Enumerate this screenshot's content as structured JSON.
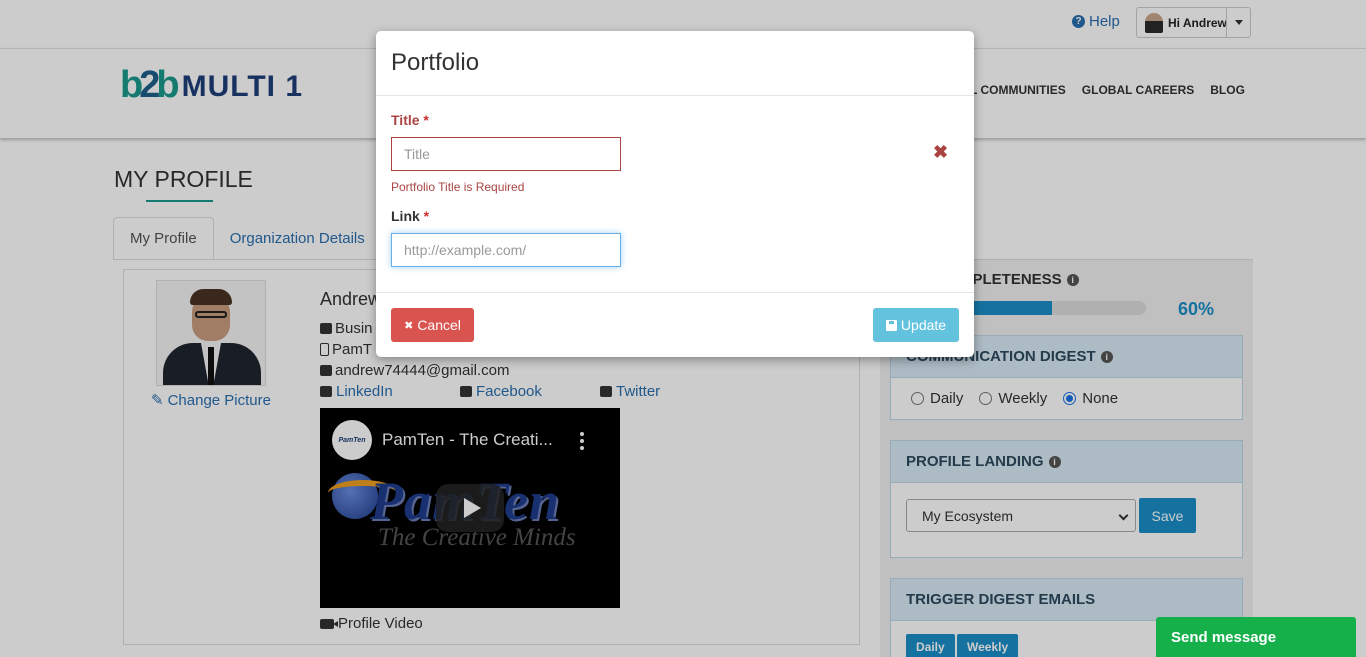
{
  "topbar": {
    "help_label": "Help",
    "help_icon_glyph": "?",
    "user_greeting": "Hi Andrew"
  },
  "brand": {
    "logo_mark_b": "b",
    "logo_mark_2": "2",
    "logo_mark_b2": "b",
    "logo_text": "MULTI 1"
  },
  "nav": {
    "items": [
      "L COMMUNITIES",
      "GLOBAL CAREERS",
      "BLOG"
    ]
  },
  "page": {
    "title": "MY PROFILE"
  },
  "tabs": [
    {
      "label": "My Profile",
      "active": true
    },
    {
      "label": "Organization Details",
      "active": false
    }
  ],
  "profile": {
    "change_picture": "Change Picture",
    "name": "Andrew",
    "business": "Busin",
    "org": "PamT",
    "email": "andrew74444@gmail.com",
    "social": {
      "linkedin": "LinkedIn",
      "facebook": "Facebook",
      "twitter": "Twitter"
    },
    "video": {
      "channel_badge": "PamTen",
      "title": "PamTen - The Creati...",
      "brand_text": "PamTen",
      "tagline": "The Creative Minds"
    },
    "video_label": "Profile Video"
  },
  "sidebar": {
    "completeness_label": "MPLETENESS",
    "completeness_value": 60,
    "completeness_text": "60%",
    "digest": {
      "title": "COMMUNICATION DIGEST",
      "options": [
        "Daily",
        "Weekly",
        "None"
      ],
      "selected": "None"
    },
    "landing": {
      "title": "PROFILE LANDING",
      "selected": "My Ecosystem",
      "save_label": "Save"
    },
    "trigger": {
      "title": "TRIGGER DIGEST EMAILS",
      "buttons": [
        "Daily",
        "Weekly"
      ]
    }
  },
  "chat": {
    "label": "Send message"
  },
  "modal": {
    "title": "Portfolio",
    "title_field": {
      "label": "Title",
      "required_mark": "*",
      "placeholder": "Title",
      "error": "Portfolio Title is Required"
    },
    "link_field": {
      "label": "Link",
      "required_mark": "*",
      "placeholder": "http://example.com/"
    },
    "remove_glyph": "✖",
    "cancel_label": "Cancel",
    "cancel_glyph": "✖",
    "update_label": "Update"
  },
  "colors": {
    "accent": "#1b8fc9",
    "error": "#a94442",
    "danger": "#d9534f",
    "info": "#5bc0de",
    "chat": "#15b04a"
  }
}
